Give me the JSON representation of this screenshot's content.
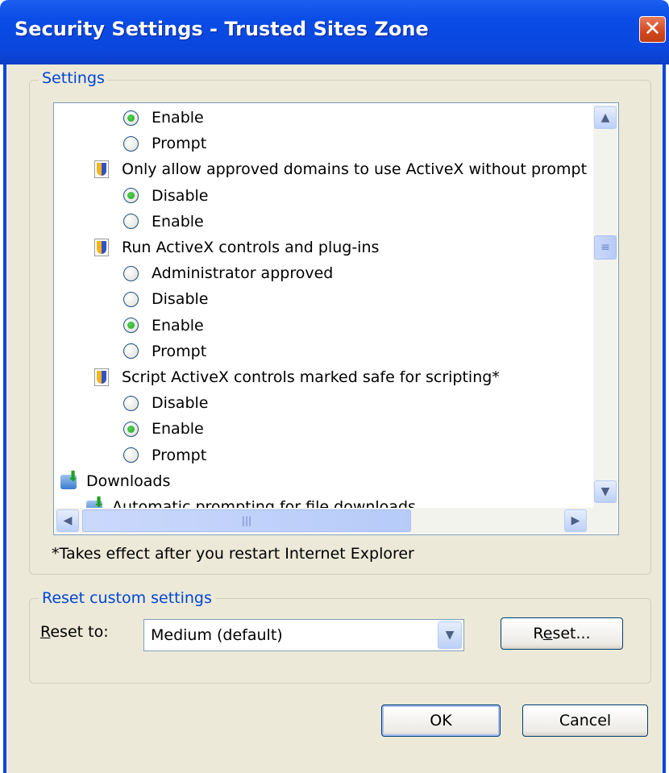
{
  "window": {
    "title": "Security Settings - Trusted Sites Zone",
    "close_label": "✕"
  },
  "settings": {
    "legend": "Settings",
    "rows": [
      {
        "kind": "radio",
        "label": "Enable",
        "checked": true
      },
      {
        "kind": "radio",
        "label": "Prompt",
        "checked": false
      },
      {
        "kind": "setting",
        "label": "Only allow approved domains to use ActiveX without prompt",
        "icon": "shield-icon"
      },
      {
        "kind": "radio",
        "label": "Disable",
        "checked": true
      },
      {
        "kind": "radio",
        "label": "Enable",
        "checked": false
      },
      {
        "kind": "setting",
        "label": "Run ActiveX controls and plug-ins",
        "icon": "shield-icon"
      },
      {
        "kind": "radio",
        "label": "Administrator approved",
        "checked": false
      },
      {
        "kind": "radio",
        "label": "Disable",
        "checked": false
      },
      {
        "kind": "radio",
        "label": "Enable",
        "checked": true
      },
      {
        "kind": "radio",
        "label": "Prompt",
        "checked": false
      },
      {
        "kind": "setting",
        "label": "Script ActiveX controls marked safe for scripting*",
        "icon": "shield-icon"
      },
      {
        "kind": "radio",
        "label": "Disable",
        "checked": false
      },
      {
        "kind": "radio",
        "label": "Enable",
        "checked": true
      },
      {
        "kind": "radio",
        "label": "Prompt",
        "checked": false
      },
      {
        "kind": "category",
        "label": "Downloads",
        "icon": "download-icon"
      },
      {
        "kind": "subcategory",
        "label": "Automatic prompting for file downloads",
        "icon": "download-icon"
      }
    ],
    "note": "*Takes effect after you restart Internet Explorer",
    "scroll": {
      "up_icon": "▲",
      "down_icon": "▼",
      "left_icon": "◀",
      "right_icon": "▶",
      "grip": "≡",
      "hgrip": "|||"
    }
  },
  "reset": {
    "legend": "Reset custom settings",
    "label_prefix": "R",
    "label_rest": "eset to:",
    "selected": "Medium (default)",
    "dropdown_icon": "▼",
    "button_prefix": "R",
    "button_under": "e",
    "button_rest": "set..."
  },
  "buttons": {
    "ok": "OK",
    "cancel": "Cancel"
  },
  "colors": {
    "titlebar": "#0a46dc",
    "legend_text": "#0046d5",
    "face": "#ece9d8"
  }
}
